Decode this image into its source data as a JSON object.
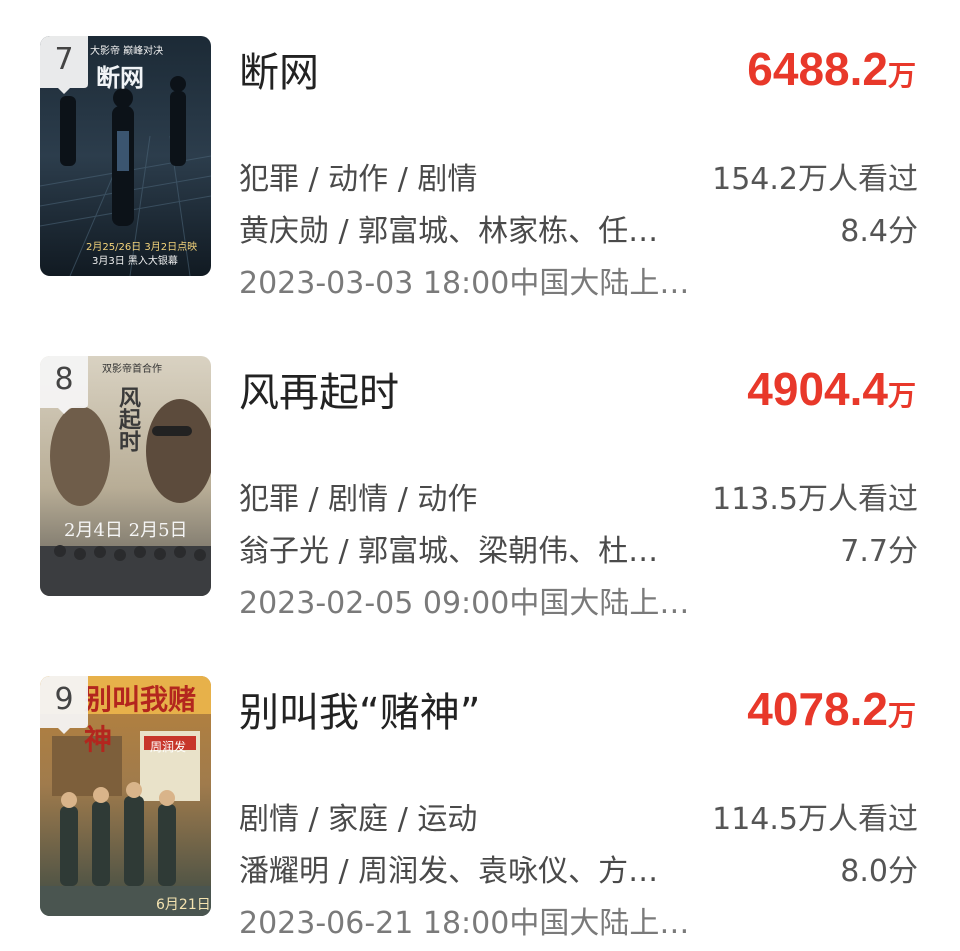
{
  "movies": [
    {
      "rank": "7",
      "title": "断网",
      "box_office_value": "6488.2",
      "box_office_unit": "万",
      "genres": "犯罪 / 动作 / 剧情",
      "cast": "黄庆勋 / 郭富城、林家栋、任…",
      "release": "2023-03-03 18:00中国大陆上…",
      "viewers": "154.2万人看过",
      "score": "8.4分",
      "poster": {
        "title": "断网",
        "tagline": "大影帝  巅峰对决",
        "footer1": "2月25/26日 3月2日点映",
        "footer2": "3月3日 黑入大银幕"
      }
    },
    {
      "rank": "8",
      "title": "风再起时",
      "box_office_value": "4904.4",
      "box_office_unit": "万",
      "genres": "犯罪 / 剧情 / 动作",
      "cast": "翁子光 / 郭富城、梁朝伟、杜…",
      "release": "2023-02-05 09:00中国大陆上…",
      "viewers": "113.5万人看过",
      "score": "7.7分",
      "poster": {
        "title": "风起时",
        "tagline": "双影帝首合作",
        "footer1": "2月4日  2月5日"
      }
    },
    {
      "rank": "9",
      "title": "别叫我“赌神”",
      "box_office_value": "4078.2",
      "box_office_unit": "万",
      "genres": "剧情 / 家庭 / 运动",
      "cast": "潘耀明 / 周润发、袁咏仪、方…",
      "release": "2023-06-21 18:00中国大陆上…",
      "viewers": "114.5万人看过",
      "score": "8.0分",
      "poster": {
        "title": "别叫我赌神",
        "sign": "周润发",
        "footer1": "6月21日"
      }
    }
  ],
  "colors": {
    "accent": "#e8382a",
    "badge_bg": "#f4f4f4"
  }
}
